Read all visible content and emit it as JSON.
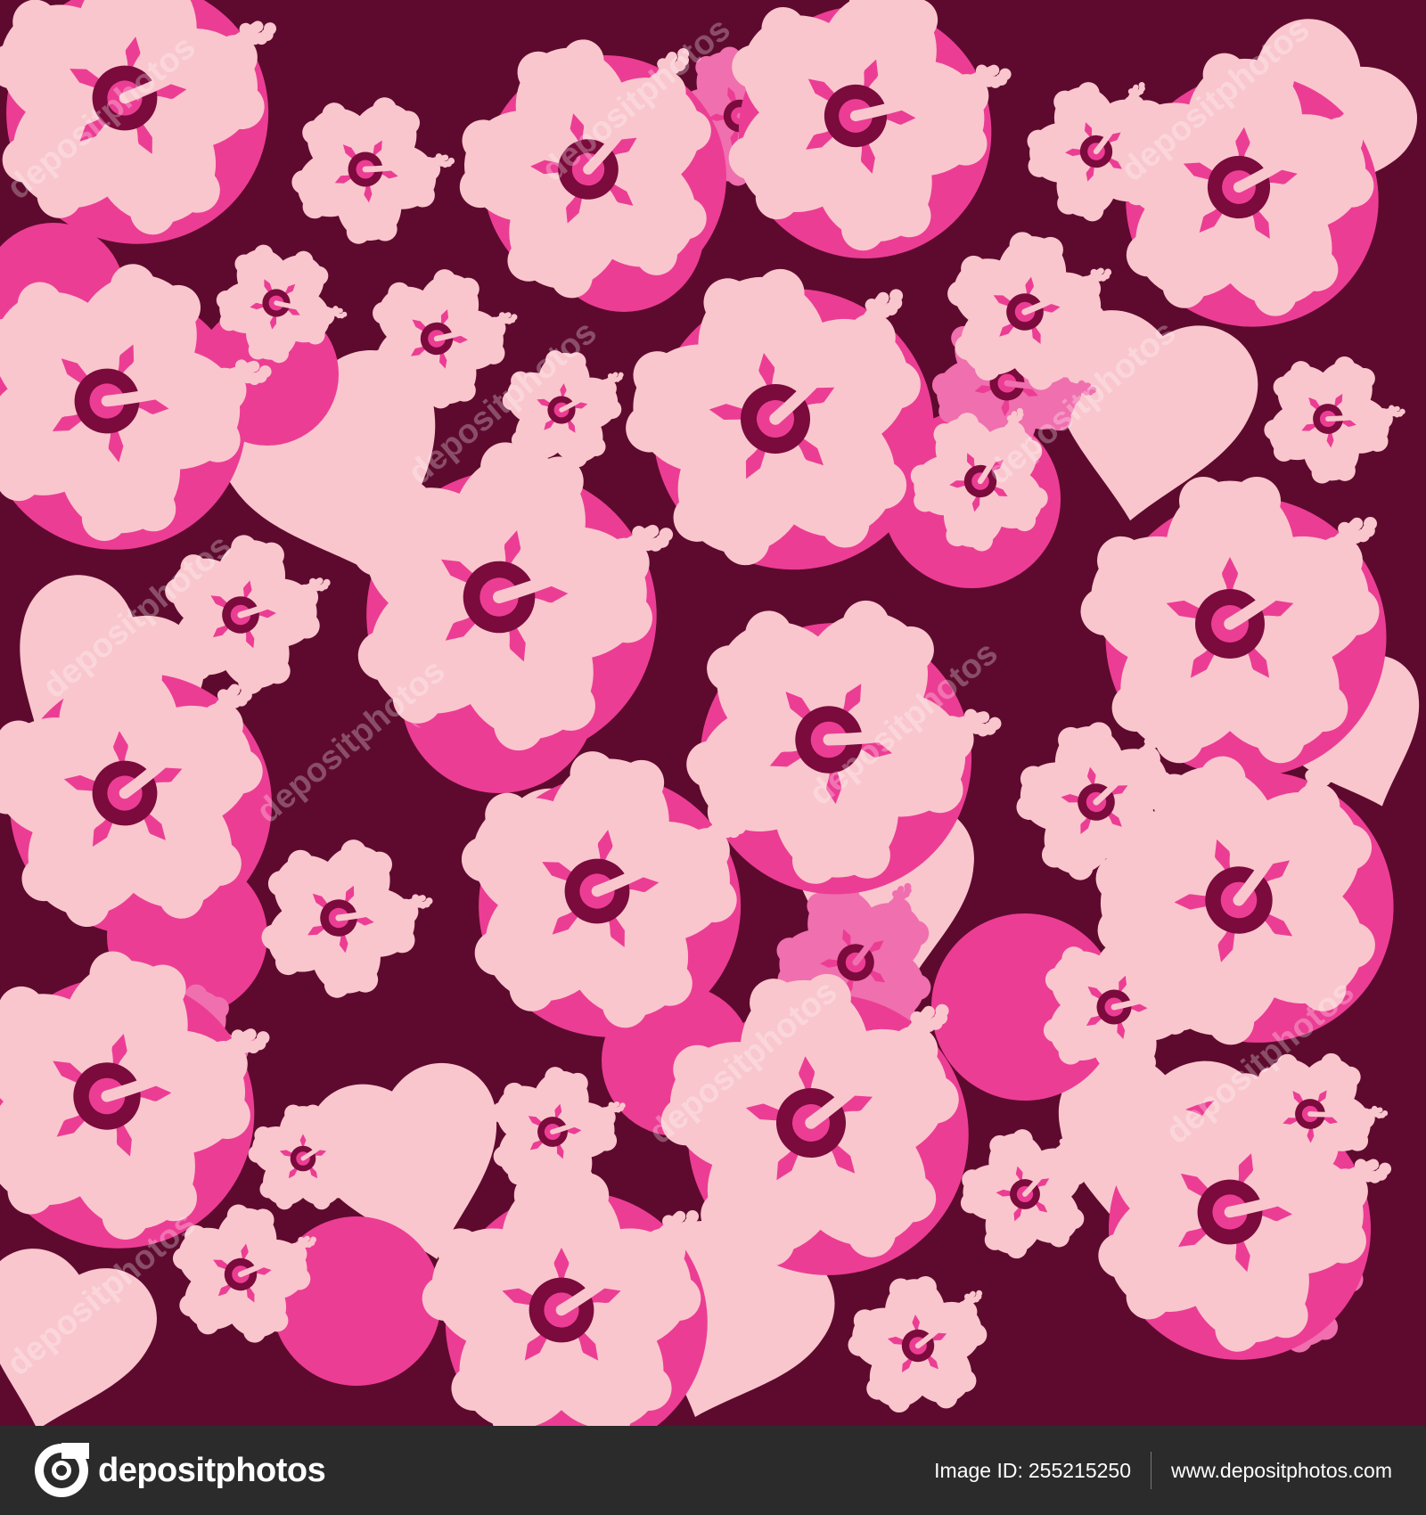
{
  "pattern": {
    "colors": {
      "background": "#5e0a2e",
      "leaf_dark": "#ec3d94",
      "flower_mid": "#f06fae",
      "flower_light": "#f9c6cd",
      "center": "#7a0b3c"
    }
  },
  "watermark": {
    "text": "depositphotos"
  },
  "footer": {
    "brand_name": "depositphotos",
    "image_id_label": "Image ID:",
    "image_id": "255215250",
    "site_url": "www.depositphotos.com",
    "background_color": "#2b2b2b"
  }
}
